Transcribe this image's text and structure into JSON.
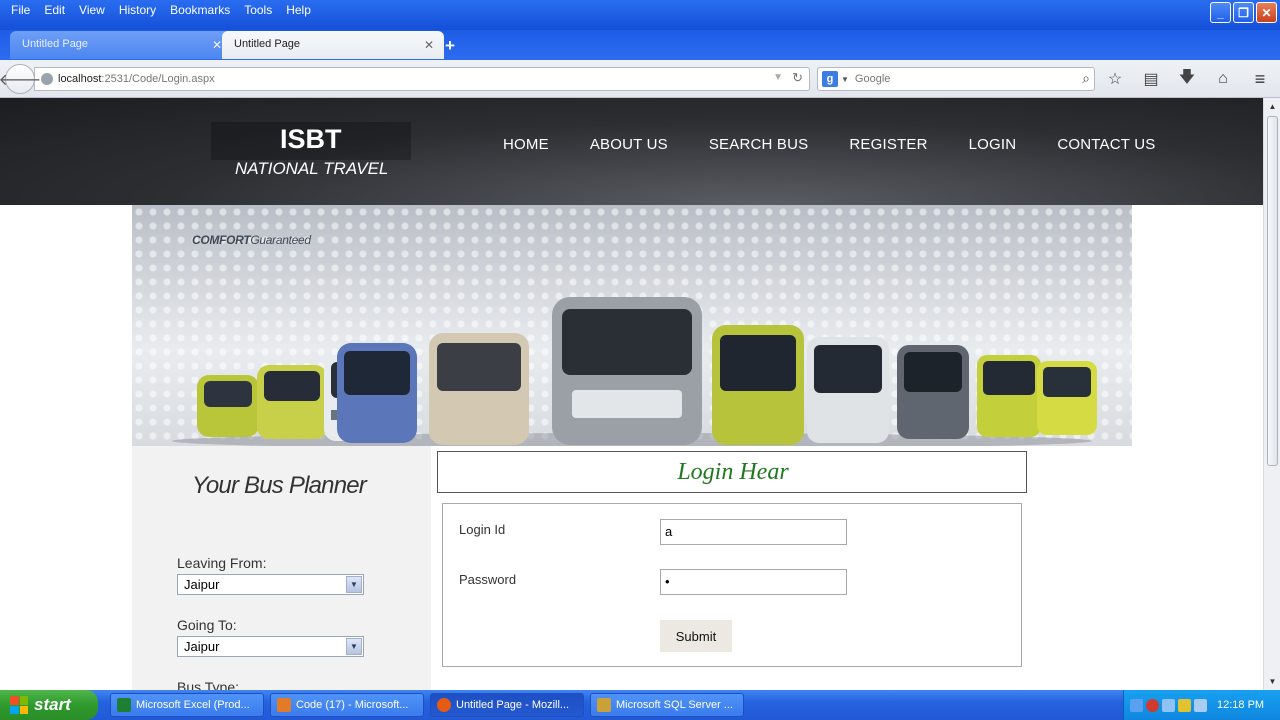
{
  "menubar": {
    "items": [
      "File",
      "Edit",
      "View",
      "History",
      "Bookmarks",
      "Tools",
      "Help"
    ]
  },
  "tabs": [
    {
      "title": "Untitled Page"
    },
    {
      "title": "Untitled Page"
    }
  ],
  "navbar": {
    "url_host": "localhost",
    "url_path": ":2531/Code/Login.aspx",
    "search_placeholder": "Google",
    "search_engine_letter": "g"
  },
  "site": {
    "logo_title": "ISBT",
    "logo_subtitle": "NATIONAL TRAVEL",
    "nav": [
      "HOME",
      "ABOUT US",
      "SEARCH BUS",
      "REGISTER",
      "LOGIN",
      "CONTACT US"
    ],
    "banner_tagline_bold": "COMFORT",
    "banner_tagline_rest": "Guaranteed"
  },
  "planner": {
    "title": "Your Bus Planner",
    "leaving_label": "Leaving From:",
    "leaving_value": "Jaipur",
    "going_label": "Going To:",
    "going_value": "Jaipur",
    "bus_type_label": "Bus Type:"
  },
  "login": {
    "heading": "Login Hear",
    "id_label": "Login Id",
    "id_value": "a",
    "password_label": "Password",
    "password_value": "•",
    "submit_label": "Submit"
  },
  "taskbar": {
    "start_label": "start",
    "items": [
      "Microsoft Excel (Prod...",
      "Code (17) - Microsoft...",
      "Untitled Page - Mozill...",
      "Microsoft SQL Server ..."
    ],
    "clock": "12:18 PM"
  },
  "colors": {
    "accent_green": "#1f7a1f",
    "header_dark": "#2c2e32",
    "xp_blue": "#2563de"
  }
}
